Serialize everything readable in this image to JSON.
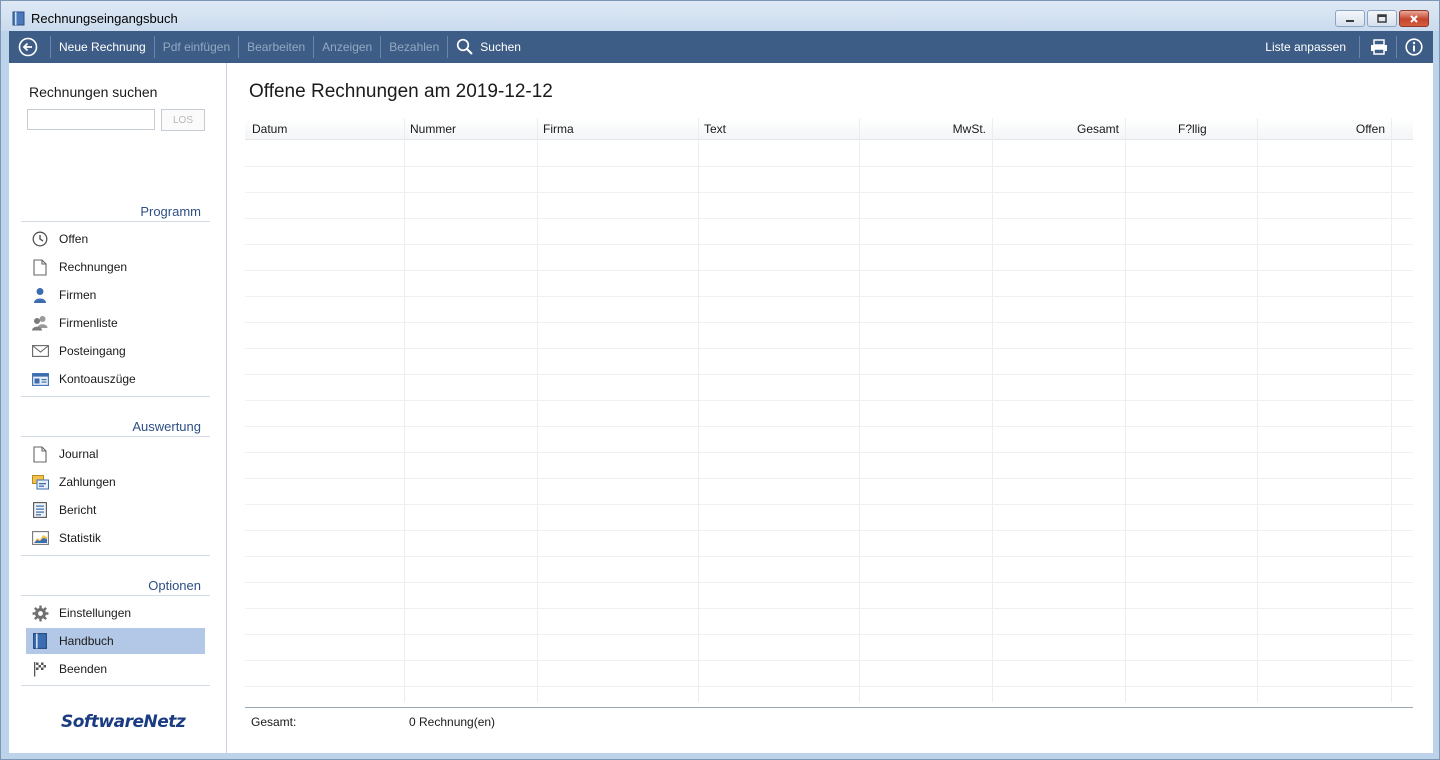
{
  "window": {
    "title": "Rechnungseingangsbuch",
    "controls": {
      "minimize": "▭",
      "restore": "▣",
      "close": "✕"
    }
  },
  "toolbar": {
    "back_icon": "back-arrow-circle-icon",
    "items": [
      {
        "label": "Neue Rechnung",
        "enabled": true
      },
      {
        "label": "Pdf einfügen",
        "enabled": false
      },
      {
        "label": "Bearbeiten",
        "enabled": false
      },
      {
        "label": "Anzeigen",
        "enabled": false
      },
      {
        "label": "Bezahlen",
        "enabled": false
      },
      {
        "label": "Suchen",
        "enabled": true,
        "icon": "search-icon"
      }
    ],
    "right": {
      "customize_label": "Liste anpassen",
      "print_icon": "printer-icon",
      "info_icon": "info-icon"
    }
  },
  "sidebar": {
    "search": {
      "title": "Rechnungen suchen",
      "value": "",
      "button_label": "LOS"
    },
    "sections": [
      {
        "title": "Programm",
        "items": [
          {
            "label": "Offen",
            "icon": "clock-icon"
          },
          {
            "label": "Rechnungen",
            "icon": "document-icon"
          },
          {
            "label": "Firmen",
            "icon": "person-icon"
          },
          {
            "label": "Firmenliste",
            "icon": "people-icon"
          },
          {
            "label": "Posteingang",
            "icon": "envelope-icon"
          },
          {
            "label": "Kontoauszüge",
            "icon": "bank-statement-icon"
          }
        ]
      },
      {
        "title": "Auswertung",
        "items": [
          {
            "label": "Journal",
            "icon": "document-icon"
          },
          {
            "label": "Zahlungen",
            "icon": "payments-icon"
          },
          {
            "label": "Bericht",
            "icon": "report-icon"
          },
          {
            "label": "Statistik",
            "icon": "chart-icon"
          }
        ]
      },
      {
        "title": "Optionen",
        "items": [
          {
            "label": "Einstellungen",
            "icon": "gear-icon"
          },
          {
            "label": "Handbuch",
            "icon": "book-icon",
            "active": true
          },
          {
            "label": "Beenden",
            "icon": "finish-flag-icon"
          }
        ]
      }
    ],
    "logo": "SoftwareNetz"
  },
  "main": {
    "title": "Offene Rechnungen am 2019-12-12",
    "columns": [
      {
        "label": "Datum",
        "align": "left"
      },
      {
        "label": "Nummer",
        "align": "left"
      },
      {
        "label": "Firma",
        "align": "left"
      },
      {
        "label": "Text",
        "align": "left"
      },
      {
        "label": "MwSt.",
        "align": "right"
      },
      {
        "label": "Gesamt",
        "align": "right"
      },
      {
        "label": "F?llig",
        "align": "left"
      },
      {
        "label": "Offen",
        "align": "right"
      }
    ],
    "rows": [],
    "footer": {
      "label": "Gesamt:",
      "count": "0 Rechnung(en)"
    }
  },
  "colors": {
    "toolbar_bg": "#3e5d86",
    "section_head": "#2e4f86",
    "active_item_bg": "#b3c8e6",
    "frame": "#bcd3ea"
  }
}
